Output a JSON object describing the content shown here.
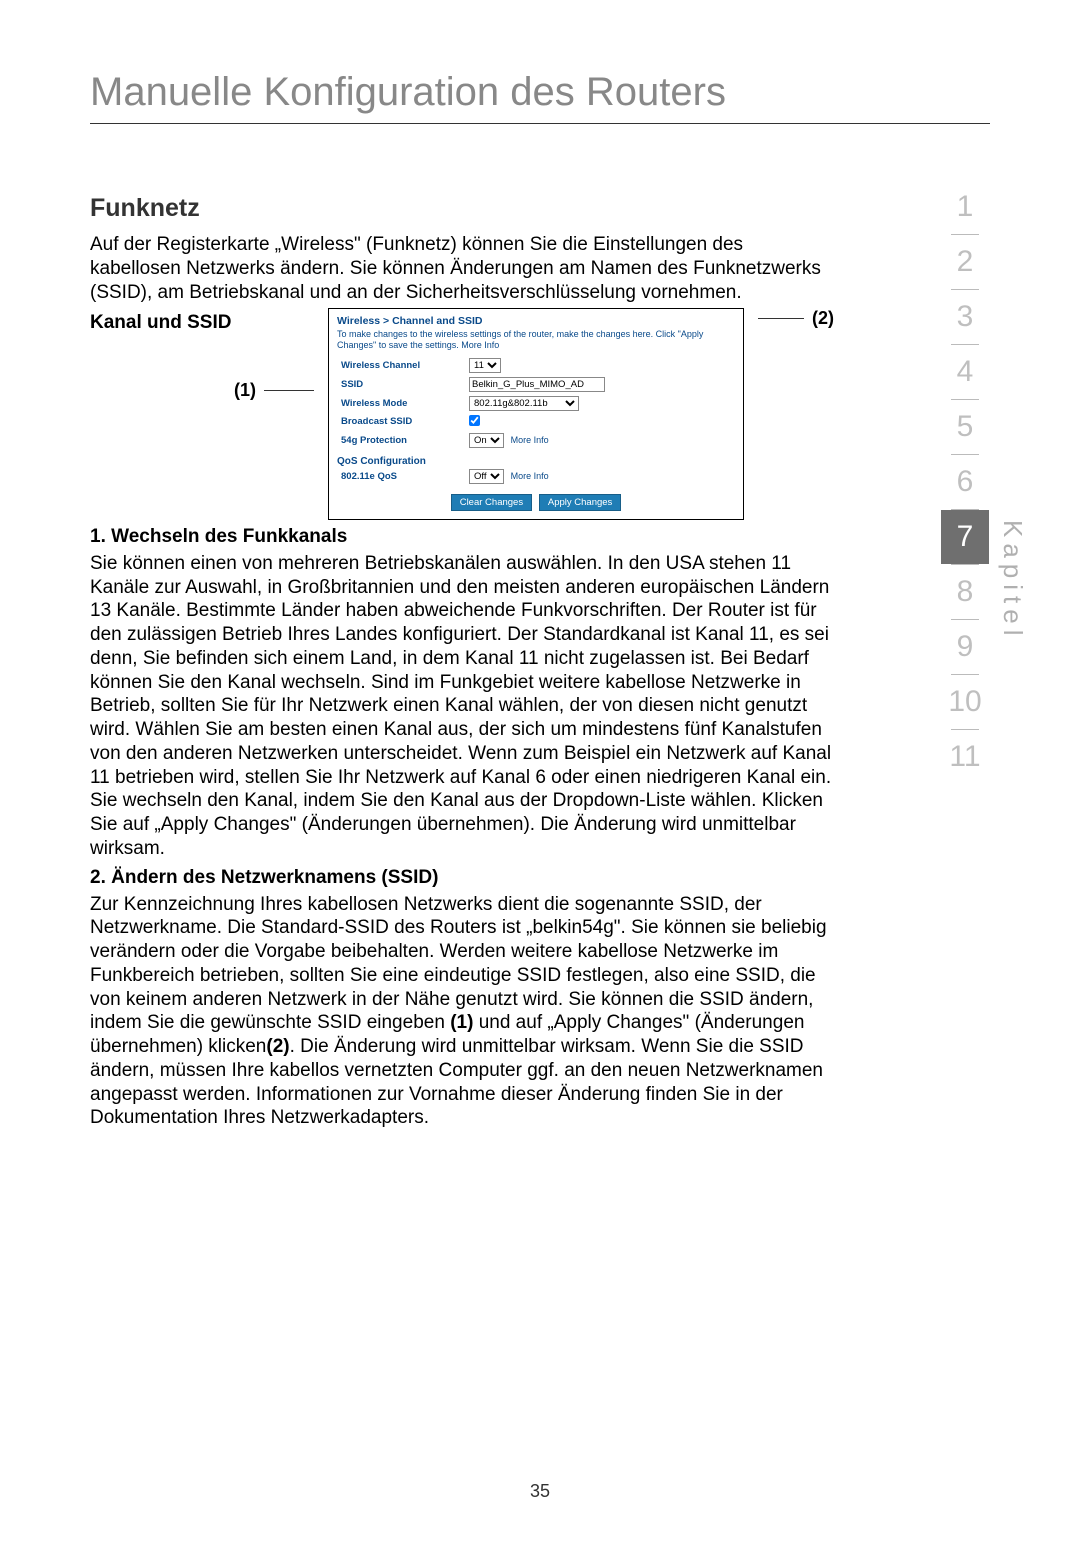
{
  "pageTitle": "Manuelle Konfiguration des Routers",
  "section": {
    "title": "Funknetz",
    "intro": "Auf der Registerkarte „Wireless\" (Funknetz) können Sie die Einstellungen des kabellosen Netzwerks ändern. Sie können Änderungen am Namen des Funknetzwerks (SSID), am Betriebskanal und an der Sicherheitsverschlüsselung vornehmen.",
    "ssidHeading": "Kanal und SSID",
    "callouts": {
      "left": "(1)",
      "right": "(2)"
    }
  },
  "routerUI": {
    "breadcrumb": "Wireless > Channel and SSID",
    "hint": "To make changes to the wireless settings of the router, make the changes here. Click \"Apply Changes\" to save the settings. More Info",
    "rows": {
      "wirelessChannelLabel": "Wireless Channel",
      "wirelessChannelValue": "11",
      "ssidLabel": "SSID",
      "ssidValue": "Belkin_G_Plus_MIMO_AD",
      "wirelessModeLabel": "Wireless Mode",
      "wirelessModeValue": "802.11g&802.11b",
      "broadcastLabel": "Broadcast SSID",
      "protectionLabel": "54g Protection",
      "protectionValue": "On",
      "qosHeading": "QoS Configuration",
      "qosLabel": "802.11e QoS",
      "qosValue": "Off",
      "moreInfo": "More Info"
    },
    "buttons": {
      "clear": "Clear Changes",
      "apply": "Apply Changes"
    }
  },
  "sub1": {
    "heading": "1. Wechseln des Funkkanals",
    "body": "Sie können einen von mehreren Betriebskanälen auswählen. In den USA stehen 11 Kanäle zur Auswahl, in Großbritannien und den meisten anderen europäischen Ländern 13 Kanäle. Bestimmte Länder haben abweichende Funkvorschriften. Der Router ist für den zulässigen Betrieb Ihres Landes konfiguriert. Der Standardkanal ist Kanal 11, es sei denn, Sie befinden sich einem Land, in dem Kanal 11 nicht zugelassen ist. Bei Bedarf können Sie den Kanal wechseln. Sind im Funkgebiet weitere kabellose Netzwerke in Betrieb, sollten Sie für Ihr Netzwerk einen Kanal wählen, der von diesen nicht genutzt wird. Wählen Sie am besten einen Kanal aus, der sich um mindestens fünf Kanalstufen von den anderen Netzwerken unterscheidet. Wenn zum Beispiel ein Netzwerk auf Kanal 11 betrieben wird, stellen Sie Ihr Netzwerk auf Kanal 6 oder einen niedrigeren Kanal ein. Sie wechseln den Kanal, indem Sie den Kanal aus der Dropdown-Liste wählen. Klicken Sie auf „Apply Changes\" (Änderungen übernehmen). Die Änderung wird unmittelbar wirksam."
  },
  "sub2": {
    "heading": "2. Ändern des Netzwerknamens (SSID)",
    "bodyPrefix": "Zur Kennzeichnung Ihres kabellosen Netzwerks dient die sogenannte SSID, der Netzwerkname. Die Standard-SSID des Routers ist „belkin54g\". Sie können sie beliebig verändern oder die Vorgabe beibehalten. Werden weitere kabellose Netzwerke im Funkbereich betrieben, sollten Sie eine eindeutige SSID festlegen, also eine SSID, die von keinem anderen Netzwerk in der Nähe genutzt wird. Sie können die SSID ändern, indem Sie die gewünschte SSID eingeben ",
    "call1": "(1)",
    "bodyMid": " und auf „Apply Changes\" (Änderungen übernehmen) klicken",
    "call2": "(2)",
    "bodySuffix": ". Die Änderung wird unmittelbar wirksam. Wenn Sie die SSID ändern, müssen Ihre kabellos vernetzten Computer ggf. an den neuen Netzwerknamen angepasst werden. Informationen zur Vornahme dieser Änderung finden Sie in der Dokumentation Ihres Netzwerkadapters."
  },
  "sidebar": {
    "chapters": [
      "1",
      "2",
      "3",
      "4",
      "5",
      "6",
      "7",
      "8",
      "9",
      "10",
      "11"
    ],
    "active": "7",
    "label": "Kapitel"
  },
  "pageNumber": "35"
}
